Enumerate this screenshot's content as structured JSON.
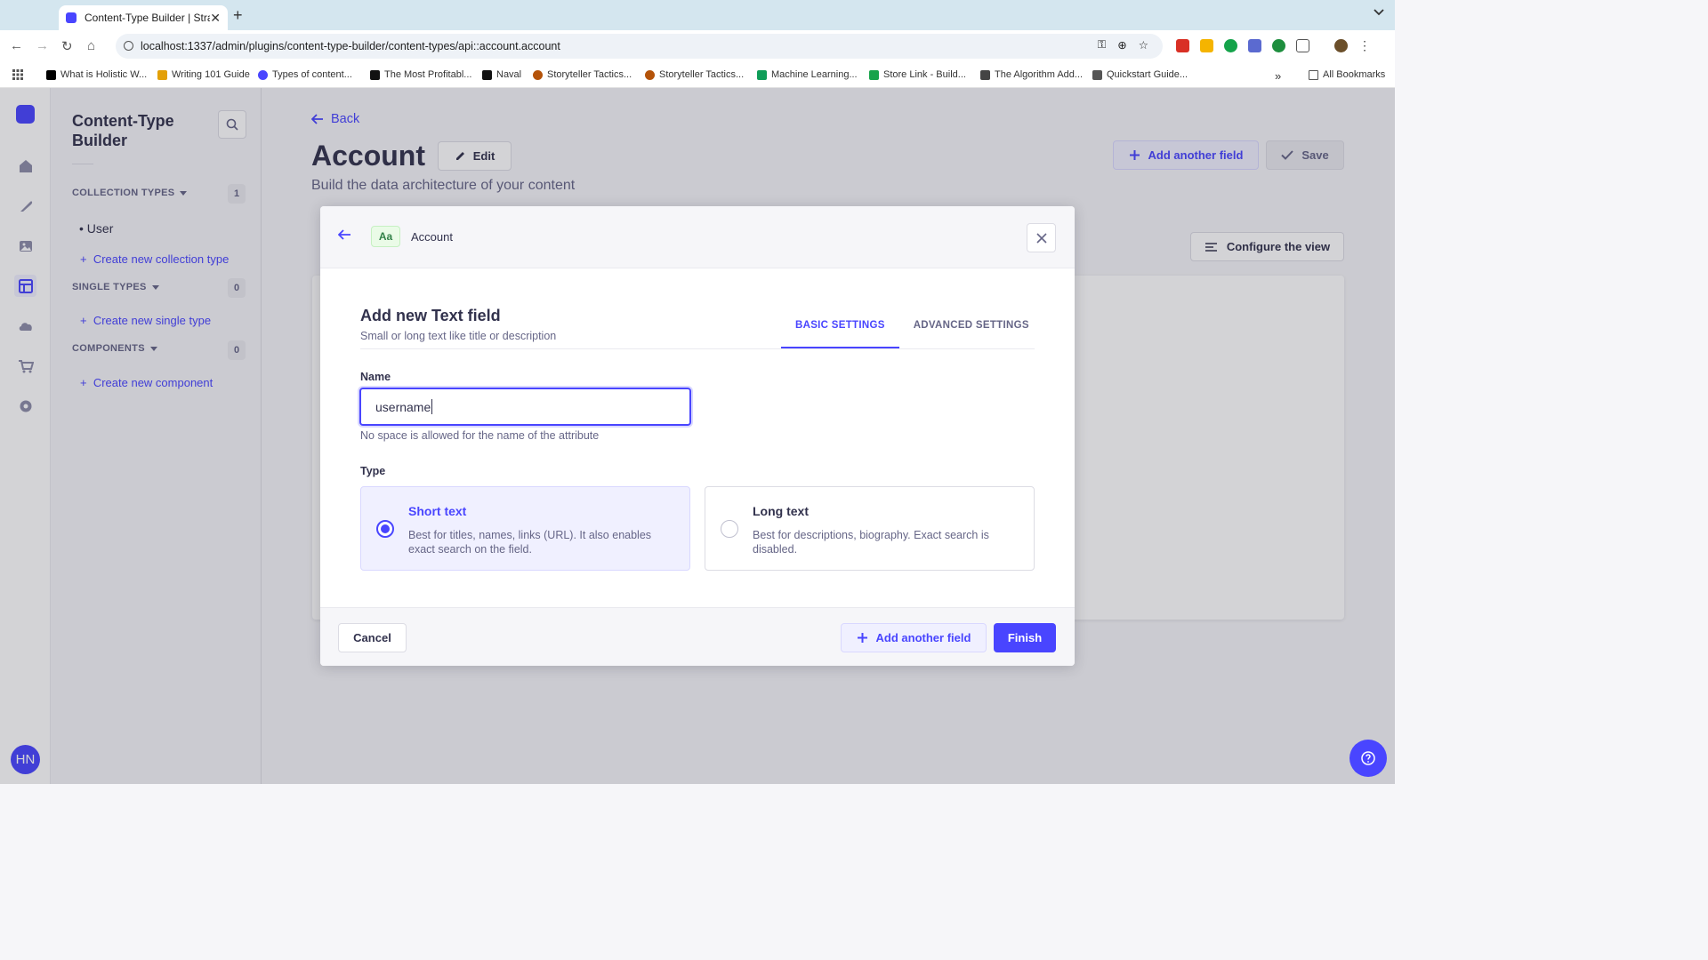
{
  "browser": {
    "tab_title": "Content-Type Builder | Strapi",
    "url": "localhost:1337/admin/plugins/content-type-builder/content-types/api::account.account",
    "bookmarks": [
      "What is Holistic W...",
      "Writing 101 Guide",
      "Types of content...",
      "The Most Profitabl...",
      "Naval",
      "Storyteller Tactics...",
      "Storyteller Tactics...",
      "Machine Learning...",
      "Store Link - Build...",
      "The Algorithm Add...",
      "Quickstart Guide..."
    ],
    "all_bookmarks": "All Bookmarks"
  },
  "sidebar": {
    "title": "Content-Type Builder",
    "collection_types": {
      "label": "COLLECTION TYPES",
      "count": "1",
      "items": [
        "User"
      ],
      "create": "Create new collection type"
    },
    "single_types": {
      "label": "SINGLE TYPES",
      "count": "0",
      "create": "Create new single type"
    },
    "components": {
      "label": "COMPONENTS",
      "count": "0",
      "create": "Create new component"
    }
  },
  "user": {
    "initials": "HN"
  },
  "main": {
    "back": "Back",
    "title": "Account",
    "edit": "Edit",
    "subtitle": "Build the data architecture of your content",
    "add_another_field": "Add another field",
    "save": "Save",
    "configure_view": "Configure the view"
  },
  "modal": {
    "badge": "Aa",
    "breadcrumb": "Account",
    "title": "Add new Text field",
    "subtitle": "Small or long text like title or description",
    "tabs": [
      "BASIC SETTINGS",
      "ADVANCED SETTINGS"
    ],
    "name_label": "Name",
    "name_value": "username",
    "name_hint": "No space is allowed for the name of the attribute",
    "type_label": "Type",
    "options": [
      {
        "title": "Short text",
        "description": "Best for titles, names, links (URL). It also enables exact search on the field.",
        "selected": true
      },
      {
        "title": "Long text",
        "description": "Best for descriptions, biography. Exact search is disabled.",
        "selected": false
      }
    ],
    "cancel": "Cancel",
    "add_another_field": "Add another field",
    "finish": "Finish"
  },
  "colors": {
    "primary": "#4945ff",
    "primary_light": "#f0f0ff",
    "text": "#32324d",
    "muted": "#666687"
  }
}
